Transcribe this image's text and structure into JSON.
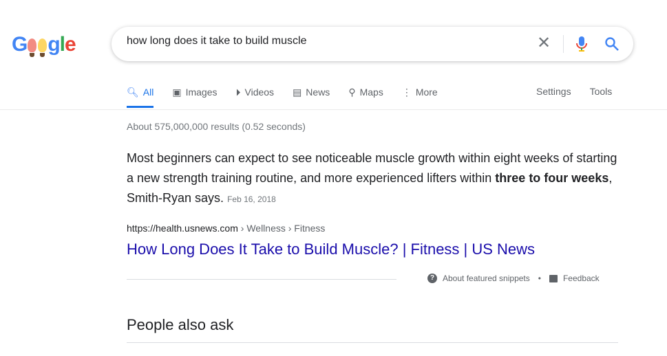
{
  "logo": {
    "text": "Google"
  },
  "search": {
    "query": "how long does it take to build muscle"
  },
  "tabs": [
    {
      "label": "All",
      "icon": "search-icon"
    },
    {
      "label": "Images",
      "icon": "image-icon"
    },
    {
      "label": "Videos",
      "icon": "play-icon"
    },
    {
      "label": "News",
      "icon": "news-icon"
    },
    {
      "label": "Maps",
      "icon": "pin-icon"
    },
    {
      "label": "More",
      "icon": "dots-icon"
    }
  ],
  "tools": {
    "settings": "Settings",
    "tools": "Tools"
  },
  "stats": "About 575,000,000 results (0.52 seconds)",
  "snippet": {
    "text": "Most beginners can expect to see noticeable muscle growth within eight weeks of starting a new strength training routine, and more experienced lifters within ",
    "bold": "three to four weeks",
    "tail": ", Smith-Ryan says.",
    "date": "Feb 16, 2018"
  },
  "result": {
    "domain": "https://health.usnews.com",
    "path": " › Wellness › Fitness",
    "title": "How Long Does It Take to Build Muscle? | Fitness | US News"
  },
  "footer": {
    "about": "About featured snippets",
    "dot": "•",
    "feedback": "Feedback"
  },
  "paa": "People also ask",
  "colors": {
    "accent": "#1a73e8",
    "link": "#1a0dab"
  }
}
